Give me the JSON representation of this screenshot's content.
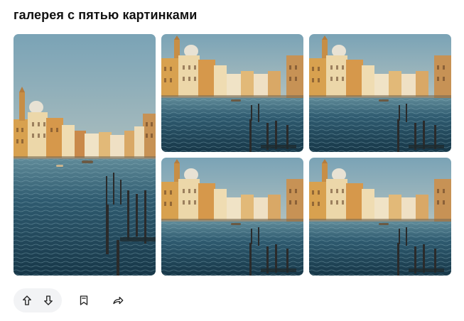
{
  "post": {
    "title": "галерея с пятью картинками"
  },
  "gallery": {
    "images": [
      {
        "subject": "venice-grand-canal"
      },
      {
        "subject": "venice-grand-canal"
      },
      {
        "subject": "venice-grand-canal"
      },
      {
        "subject": "venice-grand-canal"
      },
      {
        "subject": "venice-grand-canal"
      }
    ]
  },
  "actions": {
    "icons": [
      "upvote-icon",
      "downvote-icon",
      "bookmark-icon",
      "share-icon"
    ]
  },
  "colors": {
    "sky_top": "#7fa6b8",
    "sky_bottom": "#d8d6c8",
    "water_dark": "#1d3f52",
    "water_light": "#3f6f86",
    "buildings_warm": "#d9a55a",
    "buildings_cream": "#efdcb5",
    "icon": "#222222",
    "pill_bg": "#f2f3f5"
  }
}
